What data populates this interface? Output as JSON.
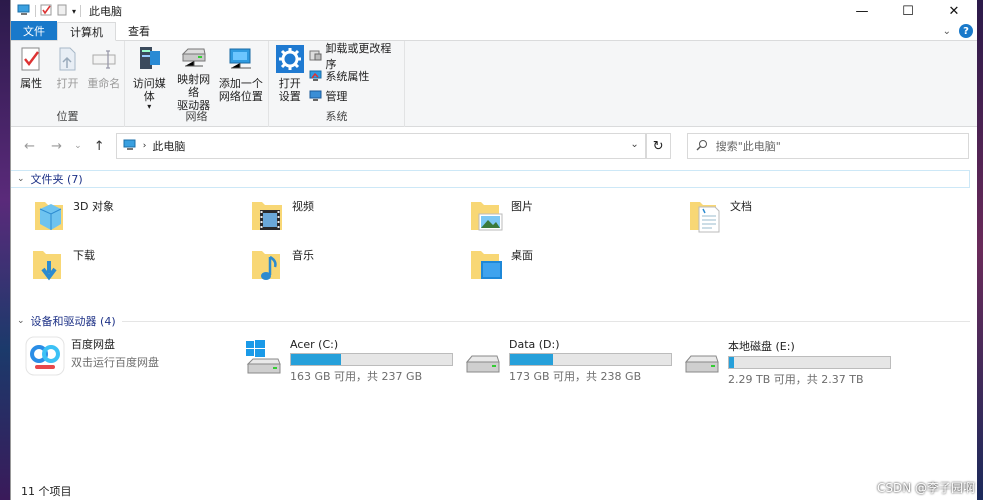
{
  "window": {
    "title": "此电脑"
  },
  "controls": {
    "minimize": "—",
    "maximize": "☐",
    "close": "✕"
  },
  "tabs": {
    "file": "文件",
    "computer": "计算机",
    "view": "查看"
  },
  "ribbon": {
    "groups": {
      "location": {
        "label": "位置",
        "buttons": {
          "properties": "属性",
          "open": "打开",
          "rename": "重命名"
        }
      },
      "network": {
        "label": "网络",
        "buttons": {
          "access_media": "访问媒体",
          "map_drive_1": "映射网络",
          "map_drive_2": "驱动器",
          "add_location_1": "添加一个",
          "add_location_2": "网络位置"
        }
      },
      "system": {
        "label": "系统",
        "buttons": {
          "open_settings_1": "打开",
          "open_settings_2": "设置",
          "uninstall": "卸载或更改程序",
          "sys_props": "系统属性",
          "manage": "管理"
        }
      }
    }
  },
  "address": {
    "location": "此电脑",
    "search_placeholder": "搜索\"此电脑\""
  },
  "folders": {
    "header": "文件夹 (7)",
    "items": [
      {
        "name": "3D 对象",
        "icon": "3d-objects-folder-icon"
      },
      {
        "name": "视频",
        "icon": "videos-folder-icon"
      },
      {
        "name": "图片",
        "icon": "pictures-folder-icon"
      },
      {
        "name": "文档",
        "icon": "documents-folder-icon"
      },
      {
        "name": "下载",
        "icon": "downloads-folder-icon"
      },
      {
        "name": "音乐",
        "icon": "music-folder-icon"
      },
      {
        "name": "桌面",
        "icon": "desktop-folder-icon"
      }
    ]
  },
  "devices": {
    "header": "设备和驱动器 (4)",
    "baidu": {
      "name": "百度网盘",
      "sub": "双击运行百度网盘"
    },
    "drives": [
      {
        "name": "Acer (C:)",
        "free_text": "163 GB 可用，共 237 GB",
        "used_fraction": 0.31
      },
      {
        "name": "Data (D:)",
        "free_text": "173 GB 可用，共 238 GB",
        "used_fraction": 0.27
      },
      {
        "name": "本地磁盘 (E:)",
        "free_text": "2.29 TB 可用，共 2.37 TB",
        "used_fraction": 0.03
      }
    ]
  },
  "status": {
    "count": "11 个项目"
  },
  "watermark": "CSDN @李子园啊",
  "colors": {
    "accent": "#1979ca",
    "drive_fill": "#26a0da",
    "section_text": "#1e3287"
  }
}
